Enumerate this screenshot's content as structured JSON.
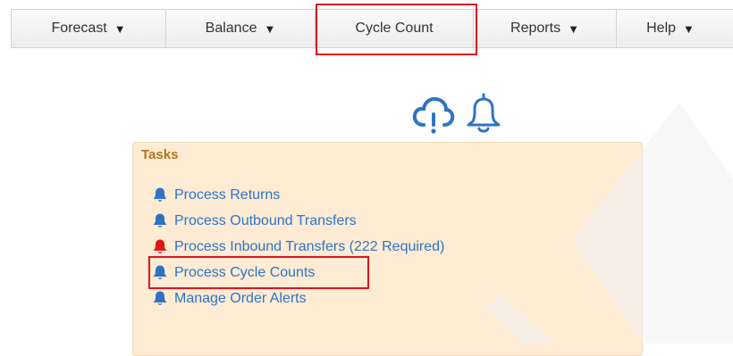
{
  "nav": {
    "items": [
      {
        "label": "Forecast",
        "dropdown": true
      },
      {
        "label": "Balance",
        "dropdown": true
      },
      {
        "label": "Cycle Count",
        "dropdown": false
      },
      {
        "label": "Reports",
        "dropdown": true
      },
      {
        "label": "Help",
        "dropdown": true
      }
    ],
    "caret": "▼"
  },
  "header_icons": [
    "cloud-alert-icon",
    "bell-outline-icon"
  ],
  "tasks": {
    "title": "Tasks",
    "items": [
      {
        "label": "Process Returns",
        "icon": "bell-icon",
        "icon_color": "#2e74c5"
      },
      {
        "label": "Process Outbound Transfers",
        "icon": "bell-icon",
        "icon_color": "#2e74c5"
      },
      {
        "label": "Process Inbound Transfers (222 Required)",
        "icon": "bell-icon",
        "icon_color": "#e01818"
      },
      {
        "label": "Process Cycle Counts",
        "icon": "bell-icon",
        "icon_color": "#2e74c5"
      },
      {
        "label": "Manage Order Alerts",
        "icon": "bell-icon",
        "icon_color": "#2e74c5"
      }
    ]
  },
  "colors": {
    "link": "#2e74c5",
    "alert": "#e01818",
    "highlight": "#e0141e",
    "panel_bg": "#fdebd4",
    "tasks_title": "#b5741e"
  }
}
